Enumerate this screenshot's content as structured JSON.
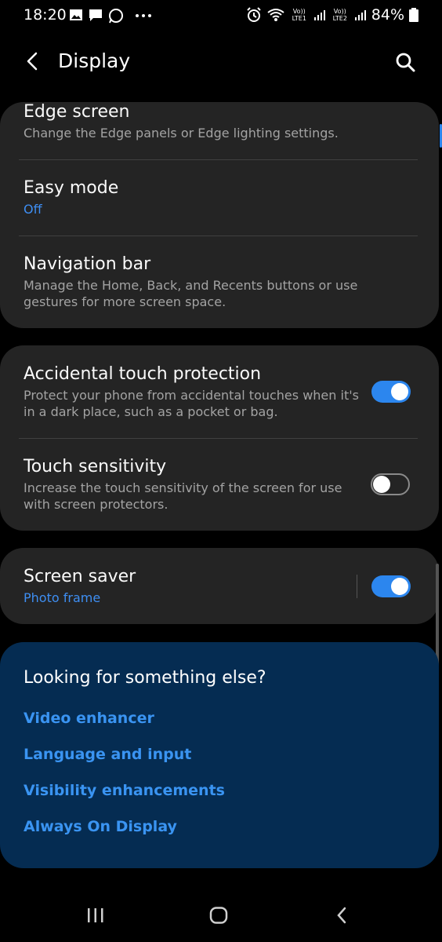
{
  "status_bar": {
    "time": "18:20",
    "lte1": "Vo)) LTE1",
    "lte2": "Vo)) LTE2",
    "battery": "84%"
  },
  "header": {
    "title": "Display"
  },
  "card1": {
    "edge_screen": {
      "title": "Edge screen",
      "subtitle": "Change the Edge panels or Edge lighting settings."
    },
    "easy_mode": {
      "title": "Easy mode",
      "subtitle": "Off"
    },
    "navigation_bar": {
      "title": "Navigation bar",
      "subtitle_line1": "Manage the Home, Back, and Recents buttons or use",
      "subtitle_line2": "gestures for more screen space."
    }
  },
  "card2": {
    "accidental": {
      "title": "Accidental touch protection",
      "subtitle_line1": "Protect your phone from accidental touches when it's",
      "subtitle_line2": "in a dark place, such as a pocket or bag.",
      "enabled": true
    },
    "touch_sensitivity": {
      "title": "Touch sensitivity",
      "subtitle_line1": "Increase the touch sensitivity of the screen for use",
      "subtitle_line2": "with screen protectors.",
      "enabled": false
    }
  },
  "card3": {
    "screen_saver": {
      "title": "Screen saver",
      "subtitle": "Photo frame",
      "enabled": true
    }
  },
  "suggestions": {
    "title": "Looking for something else?",
    "links": [
      "Video enhancer",
      "Language and input",
      "Visibility enhancements",
      "Always On Display"
    ]
  },
  "colors": {
    "accent": "#2c86ee",
    "card": "#242424",
    "suggest_bg": "#052c52"
  }
}
